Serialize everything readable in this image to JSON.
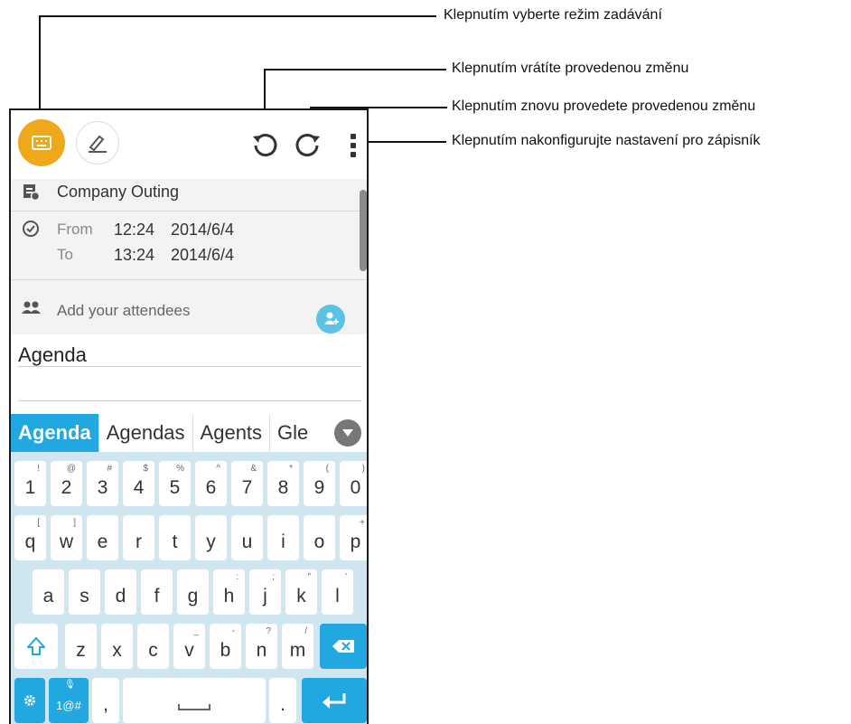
{
  "annotations": {
    "input_mode": "Klepnutím vyberte režim zadávání",
    "undo": "Klepnutím vrátíte provedenou změnu",
    "redo": "Klepnutím znovu provedete provedenou změnu",
    "settings": "Klepnutím nakonfigurujte nastavení pro zápisník"
  },
  "event": {
    "title": "Company Outing",
    "from_label": "From",
    "from_time": "12:24",
    "from_date": "2014/6/4",
    "to_label": "To",
    "to_time": "13:24",
    "to_date": "2014/6/4",
    "attendees_placeholder": "Add your attendees",
    "notes_text": "Agenda"
  },
  "suggestions": [
    "Agenda",
    "Agendas",
    "Agents",
    "Gle"
  ],
  "keyboard": {
    "row1": [
      [
        "1",
        "!"
      ],
      [
        "2",
        "@"
      ],
      [
        "3",
        "#"
      ],
      [
        "4",
        "$"
      ],
      [
        "5",
        "%"
      ],
      [
        "6",
        "^"
      ],
      [
        "7",
        "&"
      ],
      [
        "8",
        "*"
      ],
      [
        "9",
        "("
      ],
      [
        "0",
        ")"
      ]
    ],
    "row2": [
      [
        "q",
        "["
      ],
      [
        "w",
        "]"
      ],
      [
        "e",
        ""
      ],
      [
        "r",
        ""
      ],
      [
        "t",
        ""
      ],
      [
        "y",
        ""
      ],
      [
        "u",
        ""
      ],
      [
        "i",
        ""
      ],
      [
        "o",
        ""
      ],
      [
        "p",
        "+"
      ]
    ],
    "row3": [
      [
        "a",
        ""
      ],
      [
        "s",
        ""
      ],
      [
        "d",
        ""
      ],
      [
        "f",
        ""
      ],
      [
        "g",
        ""
      ],
      [
        "h",
        ":"
      ],
      [
        "j",
        ";"
      ],
      [
        "k",
        "\""
      ],
      [
        "l",
        "'"
      ]
    ],
    "row4": [
      [
        "z",
        ""
      ],
      [
        "x",
        ""
      ],
      [
        "c",
        ""
      ],
      [
        "v",
        "_"
      ],
      [
        "b",
        "-"
      ],
      [
        "n",
        "?"
      ],
      [
        "m",
        "/"
      ]
    ],
    "symbols_label": "1@#",
    "comma": ",",
    "period": "."
  },
  "colors": {
    "accent": "#f0a81b",
    "keyboard_bg": "#cfe5ef",
    "key_blue": "#22a8e0",
    "attendee_icon": "#5cc2e6"
  }
}
